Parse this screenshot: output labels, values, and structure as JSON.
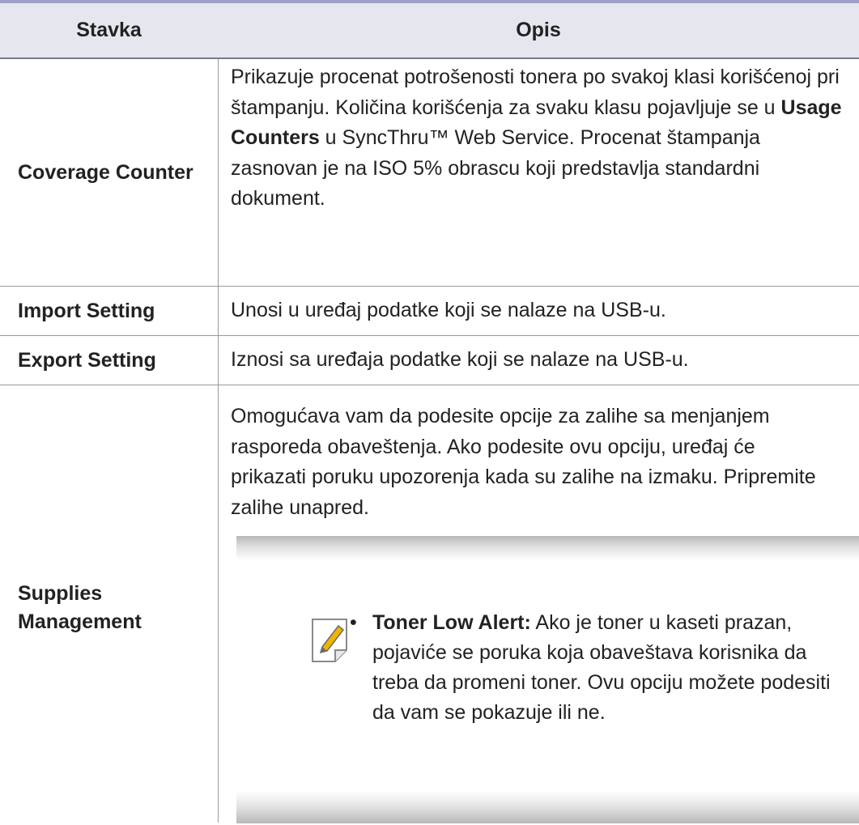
{
  "table": {
    "headers": [
      "Stavka",
      "Opis"
    ],
    "rows": [
      {
        "item": "Coverage Counter",
        "desc_part1": "Prikazuje procenat potrošenosti tonera po svakoj klasi korišćenoj pri štampanju. Količina korišćenja za svaku klasu pojavljuje se u ",
        "desc_bold": "Usage Counters",
        "desc_part2": " u SyncThru™ Web Service. Procenat štampanja zasnovan je na ISO 5% obrascu koji predstavlja standardni dokument."
      },
      {
        "item": "Import Setting",
        "desc": "Unosi u uređaj podatke koji se nalaze na USB-u."
      },
      {
        "item": "Export Setting",
        "desc": "Iznosi sa uređaja podatke koji se nalaze na USB-u."
      },
      {
        "item": "Supplies Management",
        "desc": "Omogućava vam da podesite opcije za zalihe sa menjanjem rasporeda obaveštenja. Ako podesite ovu opciju, uređaj će prikazati poruku upozorenja kada su zalihe na izmaku. Pripremite zalihe unapred.",
        "note": {
          "bullet": "•",
          "label": "Toner Low Alert:",
          "text": " Ako je toner u kaseti prazan, pojaviće se poruka koja obaveštava korisnika da treba da promeni toner. Ovu opciju možete podesiti da vam se pokazuje ili ne.",
          "icon": "note-pencil-icon"
        }
      }
    ]
  },
  "colors": {
    "top_rule": "#9e9fc9",
    "header_bg": "#e6e6ef",
    "text": "#222222",
    "icon_pencil": "#f0b400"
  }
}
